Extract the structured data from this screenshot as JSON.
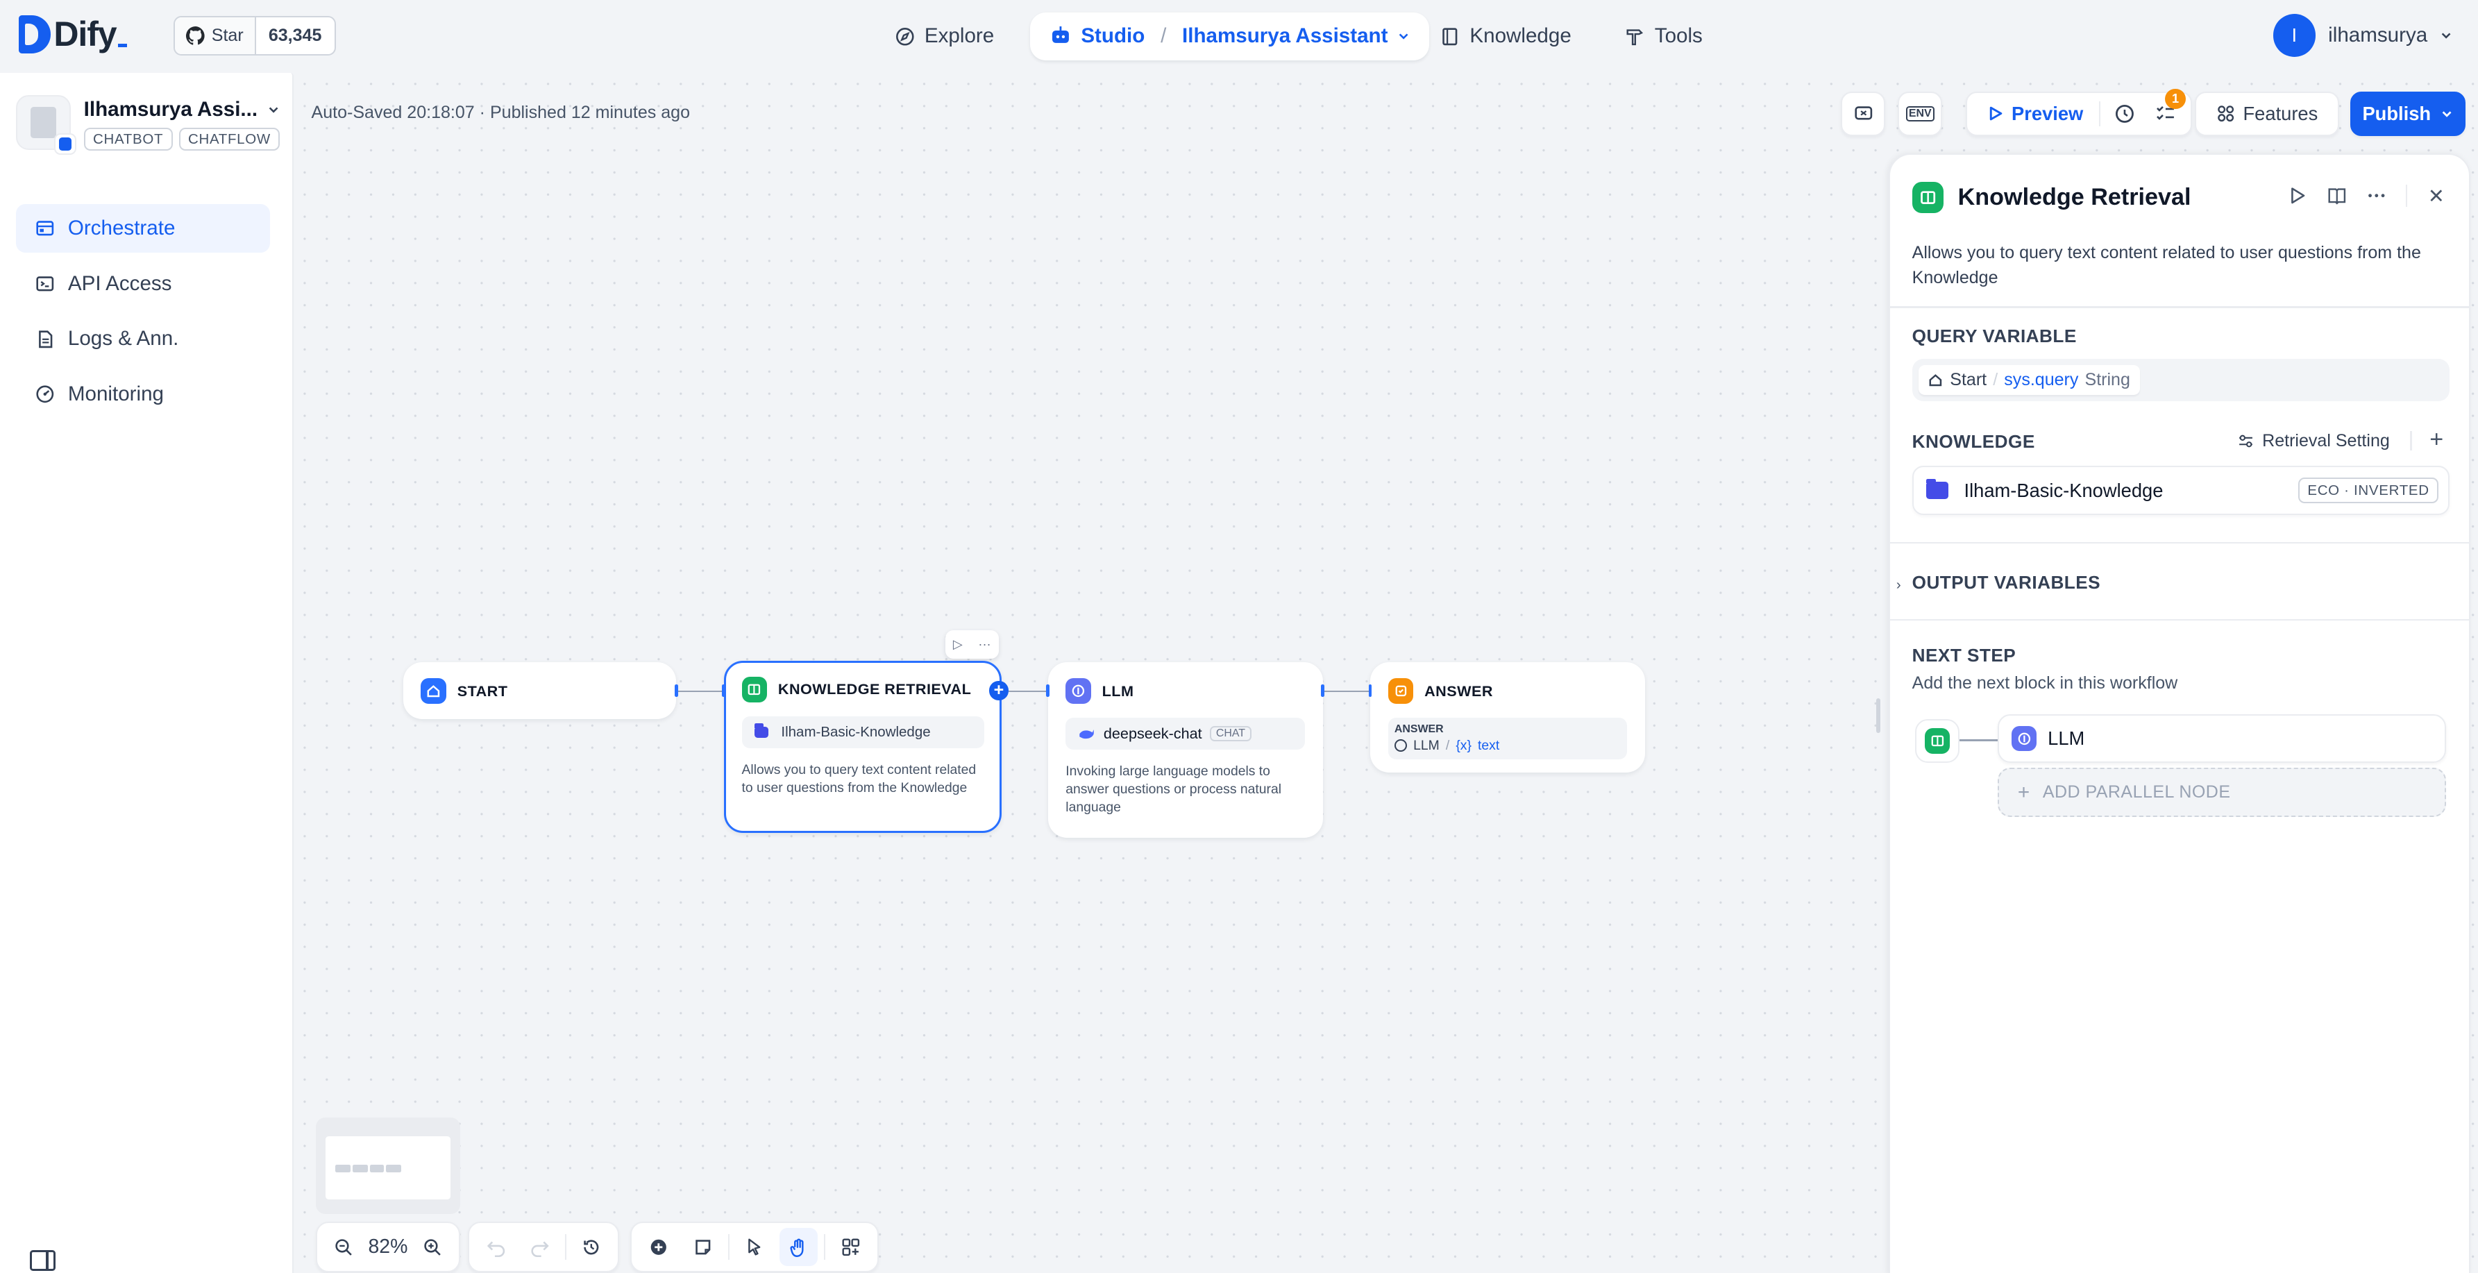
{
  "brand": {
    "name": "Dify"
  },
  "github": {
    "star_label": "Star",
    "count": "63,345"
  },
  "nav": {
    "explore": "Explore",
    "studio": "Studio",
    "app": "Ilhamsurya Assistant",
    "knowledge": "Knowledge",
    "tools": "Tools"
  },
  "user": {
    "initial": "I",
    "name": "ilhamsurya"
  },
  "app": {
    "name": "Ilhamsurya Assi...",
    "tags": [
      "CHATBOT",
      "CHATFLOW"
    ]
  },
  "sidebar": {
    "items": [
      {
        "label": "Orchestrate",
        "icon": "orchestrate-icon",
        "active": true
      },
      {
        "label": "API Access",
        "icon": "terminal-icon",
        "active": false
      },
      {
        "label": "Logs & Ann.",
        "icon": "file-list-icon",
        "active": false
      },
      {
        "label": "Monitoring",
        "icon": "dashboard-icon",
        "active": false
      }
    ]
  },
  "status": {
    "text": "Auto-Saved 20:18:07 · Published 12 minutes ago"
  },
  "toolbar": {
    "env": "ENV",
    "preview": "Preview",
    "checklist_count": "1",
    "features": "Features",
    "publish": "Publish"
  },
  "nodes": {
    "start": {
      "title": "START"
    },
    "kr": {
      "title": "KNOWLEDGE RETRIEVAL",
      "dataset": "Ilham-Basic-Knowledge",
      "desc": "Allows you to query text content related to user questions from the Knowledge"
    },
    "llm": {
      "title": "LLM",
      "model": "deepseek-chat",
      "mode": "CHAT",
      "desc": "Invoking large language models to answer questions or process natural language"
    },
    "answer": {
      "title": "ANSWER",
      "label": "ANSWER",
      "source": "LLM",
      "var": "text"
    }
  },
  "zoom": {
    "level": "82%"
  },
  "panel": {
    "title": "Knowledge Retrieval",
    "desc": "Allows you to query text content related to user questions from the Knowledge",
    "query_variable": {
      "label": "QUERY VARIABLE",
      "node": "Start",
      "var": "sys.query",
      "type": "String"
    },
    "knowledge": {
      "label": "KNOWLEDGE",
      "retrieval_setting": "Retrieval Setting",
      "item": "Ilham-Basic-Knowledge",
      "badge": "ECO · INVERTED"
    },
    "output_variables": "OUTPUT VARIABLES",
    "next_step": {
      "label": "NEXT STEP",
      "sub": "Add the next block in this workflow",
      "node": "LLM",
      "add_parallel": "ADD PARALLEL NODE"
    }
  },
  "colors": {
    "accent": "#155eef",
    "knowledge_node": "#16b364",
    "llm_node": "#6172f3",
    "answer_node": "#f79009",
    "start_node": "#2970ff"
  }
}
